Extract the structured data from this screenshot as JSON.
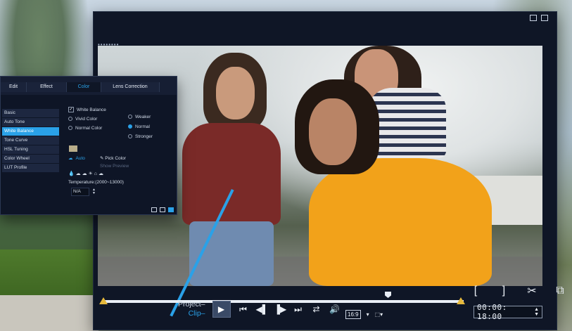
{
  "editor": {
    "grip": "••••••••",
    "transport": {
      "project_label": "Project–",
      "clip_label": "Clip–",
      "play_icon": "▶",
      "prev_icon": "⏮",
      "back_frame_icon": "◀▌",
      "fwd_frame_icon": "▐▶",
      "next_icon": "⏭",
      "repeat_icon": "⇄",
      "volume_icon": "🔊"
    },
    "aspect": {
      "ratio": "16:9",
      "ratio_dd": "▾",
      "crop_dd": "⬚▾"
    },
    "timecode": "00:00: 18:00",
    "timecode_up": "▲",
    "timecode_down": "▼",
    "tools": {
      "mark_in": "[",
      "mark_out": "]",
      "split": "✂",
      "snapshot": "⧉"
    }
  },
  "panel": {
    "tabs": [
      {
        "label": "Edit"
      },
      {
        "label": "Effect"
      },
      {
        "label": "Color"
      },
      {
        "label": "Lens Correction"
      }
    ],
    "side_items": [
      {
        "label": "Basic"
      },
      {
        "label": "Auto Tone"
      },
      {
        "label": "White Balance"
      },
      {
        "label": "Tone Curve"
      },
      {
        "label": "HSL Tuning"
      },
      {
        "label": "Color Wheel"
      },
      {
        "label": "LUT Profile"
      }
    ],
    "white_balance_label": "White Balance",
    "white_balance_check": "✓",
    "vivid_color": "Vivid Color",
    "normal_color": "Normal Color",
    "strength": {
      "weaker": "Weaker",
      "normal": "Normal",
      "stronger": "Stronger"
    },
    "auto_label": "Auto",
    "pick_color": "Pick Color",
    "show_preview": "Show Preview",
    "scene_icons": "💧 ☁ ☁ ☀ ⌂ ☁",
    "temperature_label": "Temperature:(2000~13000)",
    "temperature_value": "N/A",
    "temperature_up": "▲",
    "temperature_down": "▼"
  },
  "colors": {
    "accent": "#2aa1e8",
    "marker": "#e6b93c",
    "panel_bg": "#161e33",
    "editor_bg": "#0f1626"
  },
  "playback": {
    "playhead_position": 0.79
  }
}
